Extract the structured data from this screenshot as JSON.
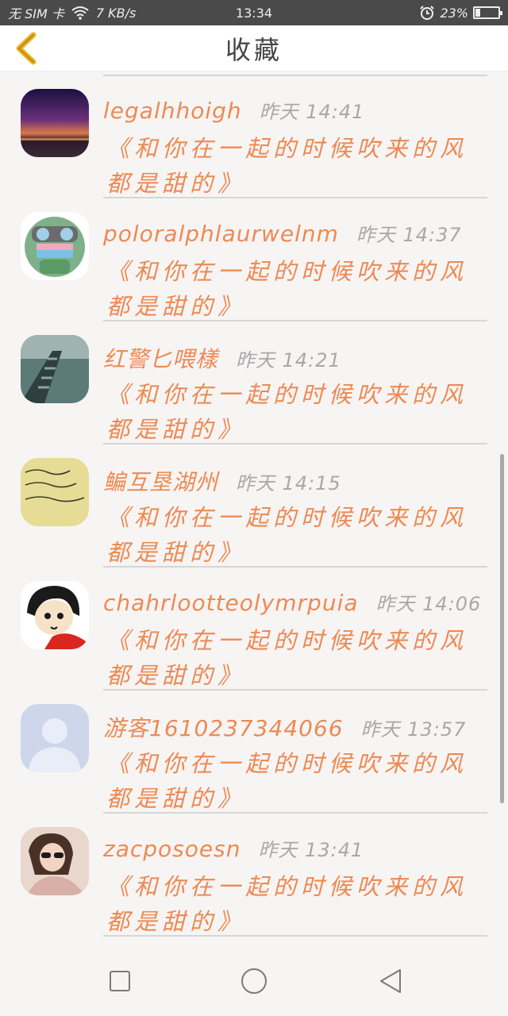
{
  "status_bar": {
    "sim": "无 SIM 卡",
    "speed": "7 KB/s",
    "time": "13:34",
    "battery": "23%",
    "battery_level": 0.23
  },
  "header": {
    "title": "收藏",
    "back_icon": "chevron-left-icon",
    "accent": "#f2b21c"
  },
  "favorites": [
    {
      "username": "legalhhoigh",
      "time": "昨天 14:41",
      "message": "《和你在一起的时候吹来的风都是甜的》",
      "avatar": "sky-sunset"
    },
    {
      "username": "poloralphlaurwelnm",
      "time": "昨天 14:37",
      "message": "《和你在一起的时候吹来的风都是甜的》",
      "avatar": "cartoon-frog-goggles"
    },
    {
      "username": "红警匕喂樣",
      "time": "昨天 14:21",
      "message": "《和你在一起的时候吹来的风都是甜的》",
      "avatar": "railing-photo"
    },
    {
      "username": "鳊互垦湖州",
      "time": "昨天 14:15",
      "message": "《和你在一起的时候吹来的风都是甜的》",
      "avatar": "handwriting-note"
    },
    {
      "username": "chahrlootteolymrpuia",
      "time": "昨天 14:06",
      "message": "《和你在一起的时候吹来的风都是甜的》",
      "avatar": "cartoon-girl"
    },
    {
      "username": "游客1610237344066",
      "time": "昨天 13:57",
      "message": "《和你在一起的时候吹来的风都是甜的》",
      "avatar": "default-user"
    },
    {
      "username": "zacposoesn",
      "time": "昨天 13:41",
      "message": "《和你在一起的时候吹来的风都是甜的》",
      "avatar": "woman-sunglasses"
    }
  ],
  "nav": {
    "recent": "square-icon",
    "home": "circle-icon",
    "back": "triangle-back-icon"
  },
  "colors": {
    "username": "#ed8a52",
    "message": "#ed8a52",
    "time": "#a8a8a8",
    "background": "#f7f4f4"
  }
}
